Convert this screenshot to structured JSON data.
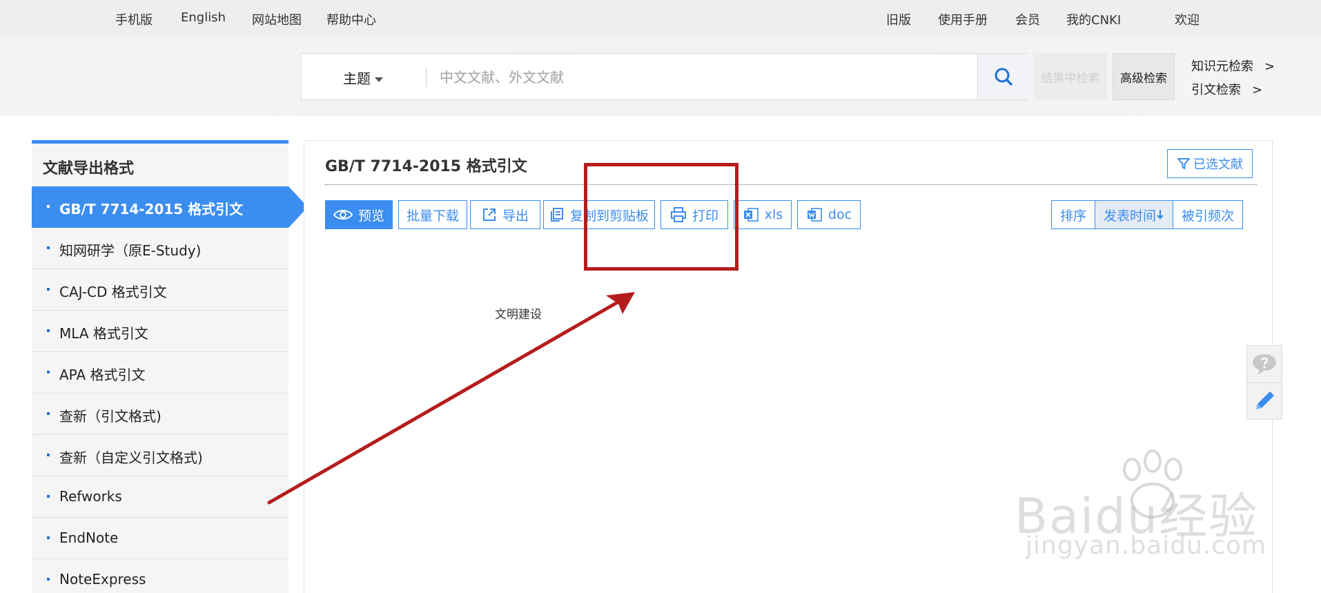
{
  "topbar": {
    "left_links": [
      "手机版",
      "English",
      "网站地图",
      "帮助中心"
    ],
    "right_links": [
      "旧版",
      "使用手册",
      "会员",
      "我的CNKI",
      "欢迎"
    ]
  },
  "search": {
    "scope": "主题",
    "placeholder": "中文文献、外文文献",
    "within_label": "结果中检索",
    "advanced_label": "高级检索",
    "links": [
      "知识元检索",
      "引文检索"
    ],
    "link_arrow": ">"
  },
  "sidebar": {
    "title": "文献导出格式",
    "items": [
      "GB/T 7714-2015 格式引文",
      "知网研学（原E-Study)",
      "CAJ-CD 格式引文",
      "MLA 格式引文",
      "APA 格式引文",
      "查新（引文格式)",
      "查新（自定义引文格式)",
      "Refworks",
      "EndNote",
      "NoteExpress"
    ],
    "active_index": 0
  },
  "main": {
    "title": "GB/T 7714-2015 格式引文",
    "selected_docs_label": "已选文献",
    "toolbar": {
      "preview": "预览",
      "batch_download": "批量下载",
      "export": "导出",
      "copy_clipboard": "复制到剪贴板",
      "print": "打印",
      "xls": "xls",
      "doc": "doc"
    },
    "sort": {
      "label": "排序",
      "by_date": "发表时间",
      "by_citations": "被引频次"
    },
    "content_text": "文明建设"
  },
  "colors": {
    "accent": "#3b8df0",
    "annotation": "#b51c1c",
    "topbar_bg": "#eeeeee"
  },
  "watermark": {
    "main": "Baidu经验",
    "sub": "jingyan.baidu.com"
  }
}
